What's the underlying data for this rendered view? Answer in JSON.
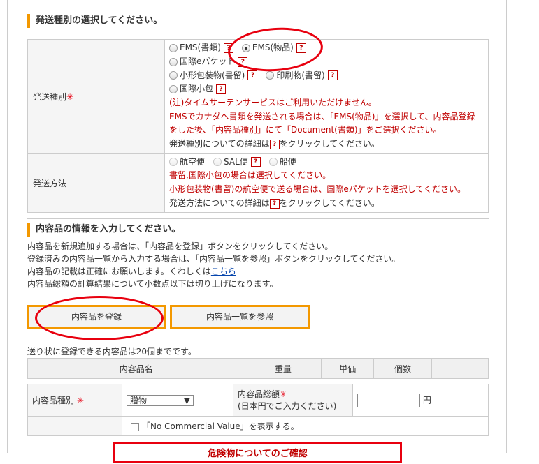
{
  "shipping_section": {
    "heading": "発送種別の選択してください。",
    "type_label": "発送種別",
    "required_mark": "✳",
    "options": {
      "ems_docs": "EMS(書類)",
      "ems_goods": "EMS(物品)",
      "intl_epacket": "国際eパケット",
      "small_packet": "小形包装物(書留)",
      "printed_matter": "印刷物(書留)",
      "intl_parcel": "国際小包"
    },
    "selected": "EMS(物品)",
    "notes": [
      "(注)タイムサーテンサービスはご利用いただけません。",
      "EMSでカナダへ書類を発送される場合は、「EMS(物品)」を選択して、内容品登録",
      "をした後、「内容品種別」にて「Document(書類)」をご選択ください。"
    ],
    "detail_prefix": "発送種別についての詳細は",
    "detail_suffix": "をクリックしてください。",
    "method_label": "発送方法",
    "methods": {
      "air": "航空便",
      "sal": "SAL便",
      "ship": "船便"
    },
    "method_notes": [
      "書留,国際小包の場合は選択してください。",
      "小形包装物(書留)の航空便で送る場合は、国際eパケットを選択してください。"
    ],
    "method_detail_prefix": "発送方法についての詳細は",
    "method_detail_suffix": "をクリックしてください。",
    "help_icon": "?"
  },
  "contents_section": {
    "heading": "内容品の情報を入力してください。",
    "intro": [
      "内容品を新規追加する場合は、「内容品を登録」ボタンをクリックしてください。",
      "登録済みの内容品一覧から入力する場合は、「内容品一覧を参照」ボタンをクリックしてください。"
    ],
    "accuracy_prefix": "内容品の記載は正確にお願いします。くわしくは",
    "accuracy_link": "こちら",
    "rounding_note": "内容品総額の計算結果について小数点以下は切り上げになります。",
    "register_button": "内容品を登録",
    "browse_button": "内容品一覧を参照",
    "max_note": "送り状に登録できる内容品は20個までです。",
    "table_headers": {
      "name": "内容品名",
      "weight": "重量",
      "unit_price": "単価",
      "quantity": "個数"
    },
    "type_label": "内容品種別",
    "type_value": "贈物",
    "total_label": "内容品総額",
    "total_note": "(日本円でご入力ください)",
    "yen": "円",
    "total_value": "",
    "no_commercial": "「No Commercial Value」を表示する。",
    "bottom_button": "危険物についてのご確認"
  },
  "colors": {
    "accent": "#f39800",
    "annotation": "#e8000f",
    "note_red": "#c00000"
  }
}
